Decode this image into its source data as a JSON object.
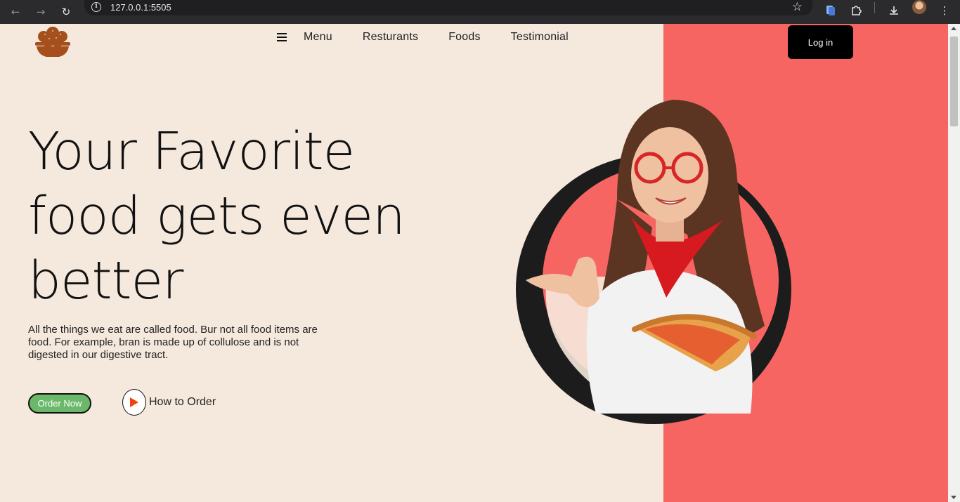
{
  "browser": {
    "url": "127.0.0.1:5505",
    "icons": [
      "back-icon",
      "forward-icon",
      "reload-icon",
      "site-info-icon",
      "bookmark-star-icon",
      "extension-icon",
      "puzzle-icon",
      "download-icon",
      "profile-avatar",
      "more-menu-icon"
    ]
  },
  "header": {
    "logo": "food-bowl-logo",
    "nav": [
      "Menu",
      "Resturants",
      "Foods",
      "Testimonial"
    ],
    "login_label": "Log in"
  },
  "hero": {
    "title_line1": "Your Favorite",
    "title_line2": "food gets even",
    "title_line3": "better",
    "description": "All the things we eat are called food. Bur not all food items are food. For example, bran is made up of collulose and is not digested in our digestive tract.",
    "order_label": "Order Now",
    "how_label": "How to Order"
  },
  "colors": {
    "page_bg": "#f5e9de",
    "accent_red": "#f76562",
    "order_green": "#6bb86a",
    "play_orange": "#f0410e",
    "logo_brown": "#a5501c"
  }
}
